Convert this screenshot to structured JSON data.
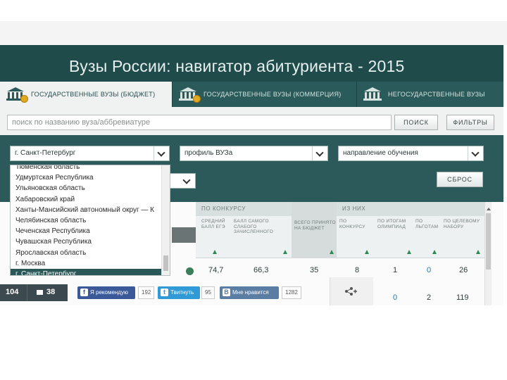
{
  "header": {
    "title": "Вузы России: навигатор абитуриента - 2015"
  },
  "tabs": [
    {
      "label": "ГОСУДАРСТВЕННЫЕ ВУЗЫ (БЮДЖЕТ)",
      "icon": "bank-coin-icon"
    },
    {
      "label": "ГОСУДАРСТВЕННЫЕ ВУЗЫ (КОММЕРЦИЯ)",
      "icon": "bank-coin-icon"
    },
    {
      "label": "НЕГОСУДАРСТВЕННЫЕ ВУЗЫ",
      "icon": "bank-icon"
    }
  ],
  "search": {
    "placeholder": "поиск по названию вуза/аббревиатуре",
    "search_label": "ПОИСК",
    "filters_label": "ФИЛЬТРЫ"
  },
  "filters": {
    "city": "г. Санкт-Петербург",
    "profile": "профиль ВУЗа",
    "direction": "направление обучения",
    "reset_label": "СБРОС"
  },
  "dropdown": {
    "items": [
      "Тюменская область",
      "Удмуртская Республика",
      "Ульяновская область",
      "Хабаровский край",
      "Ханты-Мансийский автономный округ — К",
      "Челябинская область",
      "Чеченская Республика",
      "Чувашская Республика",
      "Ярославская область",
      "г. Москва",
      "г. Санкт-Петербург"
    ],
    "selected": "г. Санкт-Петербург"
  },
  "table": {
    "group_konkurs": "ПО КОНКУРСУ",
    "group_iz_nih": "ИЗ НИХ",
    "columns": [
      "СРЕДНИЙ БАЛЛ ЕГЭ",
      "БАЛЛ САМОГО СЛАБОГО ЗАЧИСЛЕННОГО",
      "ВСЕГО ПРИНЯТО НА БЮДЖЕТ",
      "ПО КОНКУРСУ",
      "ПО ИТОГАМ ОЛИМПИАД",
      "ПО ЛЬГОТАМ",
      "ПО ЦЕЛЕВОМУ НАБОРУ"
    ],
    "row1": [
      "74,7",
      "66,3",
      "35",
      "8",
      "1",
      "0",
      "26"
    ],
    "row2": [
      "0",
      "2",
      "119"
    ]
  },
  "social": {
    "views": "104",
    "comments": "38",
    "fb_label": "Я рекомендую",
    "fb_count": "192",
    "tw_label": "Твитнуть",
    "tw_count": "95",
    "vk_label": "Мне нравится",
    "vk_count": "1282",
    "fb_logo": "f",
    "tw_logo": "t",
    "vk_logo": "В"
  }
}
